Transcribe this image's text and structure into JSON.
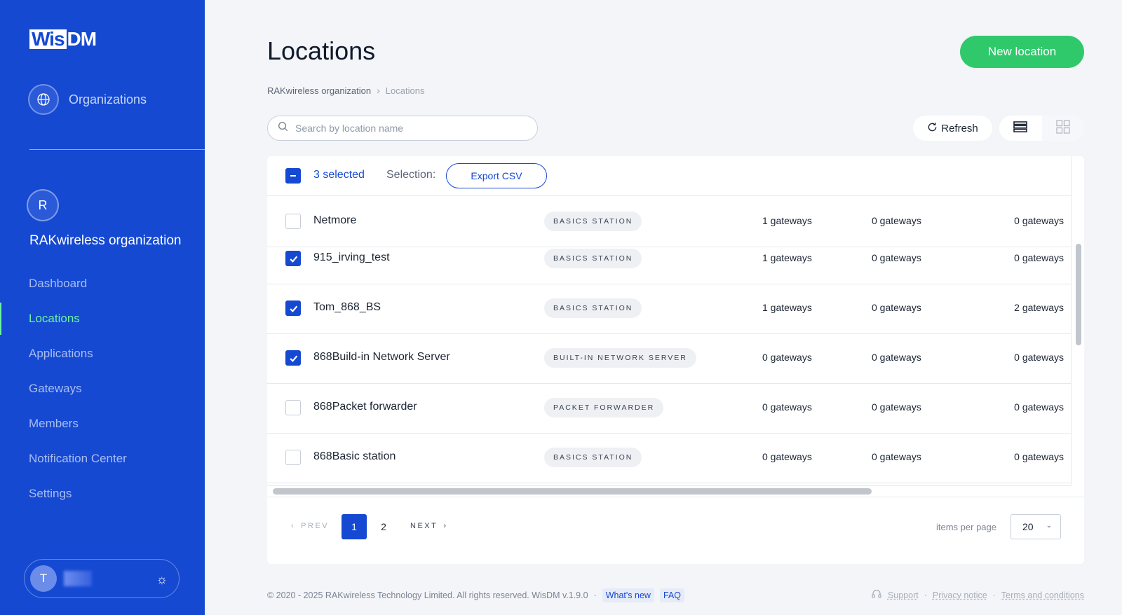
{
  "brand": {
    "logo_wis": "Wis",
    "logo_dm": "DM"
  },
  "sidebar": {
    "org_switch_label": "Organizations",
    "org_avatar_letter": "R",
    "org_name": "RAKwireless organization",
    "items": [
      {
        "label": "Dashboard"
      },
      {
        "label": "Locations",
        "active": true
      },
      {
        "label": "Applications"
      },
      {
        "label": "Gateways"
      },
      {
        "label": "Members"
      },
      {
        "label": "Notification Center"
      },
      {
        "label": "Settings"
      }
    ],
    "user_avatar_letter": "T",
    "user_name": "T",
    "settings_glyph": "☼"
  },
  "header": {
    "title": "Locations",
    "new_button": "New location"
  },
  "breadcrumb": {
    "parent": "RAKwireless organization",
    "separator": "›",
    "current": "Locations"
  },
  "toolbar": {
    "search_placeholder": "Search by location name",
    "refresh_label": "Refresh"
  },
  "selection": {
    "count_label": "3 selected",
    "selection_label": "Selection:",
    "export_label": "Export CSV"
  },
  "rows": [
    {
      "name": "Netmore",
      "type": "BASICS STATION",
      "g1": "1 gateways",
      "g2": "0 gateways",
      "g3": "0 gateways",
      "checked": false
    },
    {
      "name": "915_irving_test",
      "type": "BASICS STATION",
      "g1": "1 gateways",
      "g2": "0 gateways",
      "g3": "0 gateways",
      "checked": true
    },
    {
      "name": "Tom_868_BS",
      "type": "BASICS STATION",
      "g1": "1 gateways",
      "g2": "0 gateways",
      "g3": "2 gateways",
      "checked": true
    },
    {
      "name": "868Build-in Network Server",
      "type": "BUILT-IN NETWORK SERVER",
      "g1": "0 gateways",
      "g2": "0 gateways",
      "g3": "0 gateways",
      "checked": true
    },
    {
      "name": "868Packet forwarder",
      "type": "PACKET FORWARDER",
      "g1": "0 gateways",
      "g2": "0 gateways",
      "g3": "0 gateways",
      "checked": false
    },
    {
      "name": "868Basic station",
      "type": "BASICS STATION",
      "g1": "0 gateways",
      "g2": "0 gateways",
      "g3": "0 gateways",
      "checked": false
    }
  ],
  "pagination": {
    "prev": "PREV",
    "next": "NEXT",
    "pages": [
      "1",
      "2"
    ],
    "current_page": "1",
    "items_per_page_label": "items per page",
    "items_per_page_value": "20"
  },
  "footer": {
    "copyright": "© 2020 - 2025 RAKwireless Technology Limited. All rights reserved. WisDM v.1.9.0",
    "dot": "·",
    "whats_new": "What's new",
    "faq": "FAQ",
    "support": "Support",
    "privacy": "Privacy notice",
    "terms": "Terms and conditions"
  },
  "colors": {
    "sidebar_bg": "#1549d2",
    "accent": "#1549d2",
    "active_nav": "#6ef2a2",
    "primary_button": "#2fc96b"
  }
}
